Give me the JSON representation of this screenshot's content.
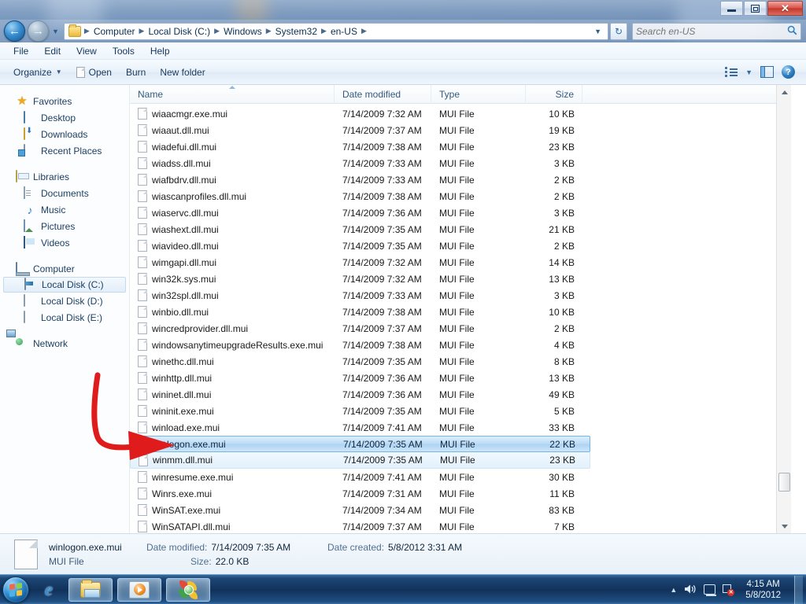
{
  "window": {
    "titlebar_buttons": [
      {
        "name": "minimize",
        "glyph": "—"
      },
      {
        "name": "restore",
        "glyph": "❐"
      },
      {
        "name": "close",
        "glyph": "✕"
      }
    ]
  },
  "address_bar": {
    "back_glyph": "←",
    "forward_glyph": "→",
    "history_caret": "▼",
    "folder_icon": "folder-icon",
    "breadcrumbs": [
      "Computer",
      "Local Disk (C:)",
      "Windows",
      "System32",
      "en-US"
    ],
    "separator": "▶",
    "dropdown_caret": "▼",
    "refresh_glyph": "↻",
    "search": {
      "placeholder": "Search en-US",
      "value": "",
      "icon": "search-icon"
    }
  },
  "menu": {
    "items": [
      "File",
      "Edit",
      "View",
      "Tools",
      "Help"
    ]
  },
  "toolbar": {
    "organize_label": "Organize",
    "organize_caret": "▼",
    "open_label": "Open",
    "burn_label": "Burn",
    "new_folder_label": "New folder",
    "view_caret": "▼",
    "help_glyph": "?"
  },
  "navigation_pane": {
    "groups": [
      {
        "root": {
          "label": "Favorites",
          "icon": "star-icon"
        },
        "children": [
          {
            "label": "Desktop",
            "icon": "desktop-icon"
          },
          {
            "label": "Downloads",
            "icon": "downloads-icon"
          },
          {
            "label": "Recent Places",
            "icon": "recent-places-icon"
          }
        ]
      },
      {
        "root": {
          "label": "Libraries",
          "icon": "libraries-icon"
        },
        "children": [
          {
            "label": "Documents",
            "icon": "documents-icon"
          },
          {
            "label": "Music",
            "icon": "music-icon"
          },
          {
            "label": "Pictures",
            "icon": "pictures-icon"
          },
          {
            "label": "Videos",
            "icon": "videos-icon"
          }
        ]
      },
      {
        "root": {
          "label": "Computer",
          "icon": "computer-icon"
        },
        "children": [
          {
            "label": "Local Disk (C:)",
            "icon": "system-drive-icon",
            "selected": true
          },
          {
            "label": "Local Disk (D:)",
            "icon": "drive-icon"
          },
          {
            "label": "Local Disk (E:)",
            "icon": "drive-icon"
          }
        ]
      },
      {
        "root": {
          "label": "Network",
          "icon": "network-icon"
        },
        "children": []
      }
    ]
  },
  "file_list": {
    "columns": [
      "Name",
      "Date modified",
      "Type",
      "Size"
    ],
    "sort_column": "Name",
    "sort_direction": "ascending",
    "rows": [
      {
        "name": "wiaacmgr.exe.mui",
        "date": "7/14/2009 7:32 AM",
        "type": "MUI File",
        "size": "10 KB"
      },
      {
        "name": "wiaaut.dll.mui",
        "date": "7/14/2009 7:37 AM",
        "type": "MUI File",
        "size": "19 KB"
      },
      {
        "name": "wiadefui.dll.mui",
        "date": "7/14/2009 7:38 AM",
        "type": "MUI File",
        "size": "23 KB"
      },
      {
        "name": "wiadss.dll.mui",
        "date": "7/14/2009 7:33 AM",
        "type": "MUI File",
        "size": "3 KB"
      },
      {
        "name": "wiafbdrv.dll.mui",
        "date": "7/14/2009 7:33 AM",
        "type": "MUI File",
        "size": "2 KB"
      },
      {
        "name": "wiascanprofiles.dll.mui",
        "date": "7/14/2009 7:38 AM",
        "type": "MUI File",
        "size": "2 KB"
      },
      {
        "name": "wiaservc.dll.mui",
        "date": "7/14/2009 7:36 AM",
        "type": "MUI File",
        "size": "3 KB"
      },
      {
        "name": "wiashext.dll.mui",
        "date": "7/14/2009 7:35 AM",
        "type": "MUI File",
        "size": "21 KB"
      },
      {
        "name": "wiavideo.dll.mui",
        "date": "7/14/2009 7:35 AM",
        "type": "MUI File",
        "size": "2 KB"
      },
      {
        "name": "wimgapi.dll.mui",
        "date": "7/14/2009 7:32 AM",
        "type": "MUI File",
        "size": "14 KB"
      },
      {
        "name": "win32k.sys.mui",
        "date": "7/14/2009 7:32 AM",
        "type": "MUI File",
        "size": "13 KB"
      },
      {
        "name": "win32spl.dll.mui",
        "date": "7/14/2009 7:33 AM",
        "type": "MUI File",
        "size": "3 KB"
      },
      {
        "name": "winbio.dll.mui",
        "date": "7/14/2009 7:38 AM",
        "type": "MUI File",
        "size": "10 KB"
      },
      {
        "name": "wincredprovider.dll.mui",
        "date": "7/14/2009 7:37 AM",
        "type": "MUI File",
        "size": "2 KB"
      },
      {
        "name": "windowsanytimeupgradeResults.exe.mui",
        "date": "7/14/2009 7:38 AM",
        "type": "MUI File",
        "size": "4 KB"
      },
      {
        "name": "winethc.dll.mui",
        "date": "7/14/2009 7:35 AM",
        "type": "MUI File",
        "size": "8 KB"
      },
      {
        "name": "winhttp.dll.mui",
        "date": "7/14/2009 7:36 AM",
        "type": "MUI File",
        "size": "13 KB"
      },
      {
        "name": "wininet.dll.mui",
        "date": "7/14/2009 7:36 AM",
        "type": "MUI File",
        "size": "49 KB"
      },
      {
        "name": "wininit.exe.mui",
        "date": "7/14/2009 7:35 AM",
        "type": "MUI File",
        "size": "5 KB"
      },
      {
        "name": "winload.exe.mui",
        "date": "7/14/2009 7:41 AM",
        "type": "MUI File",
        "size": "33 KB"
      },
      {
        "name": "winlogon.exe.mui",
        "date": "7/14/2009 7:35 AM",
        "type": "MUI File",
        "size": "22 KB",
        "selected": true
      },
      {
        "name": "winmm.dll.mui",
        "date": "7/14/2009 7:35 AM",
        "type": "MUI File",
        "size": "23 KB",
        "secondary": true
      },
      {
        "name": "winresume.exe.mui",
        "date": "7/14/2009 7:41 AM",
        "type": "MUI File",
        "size": "30 KB"
      },
      {
        "name": "Winrs.exe.mui",
        "date": "7/14/2009 7:31 AM",
        "type": "MUI File",
        "size": "11 KB"
      },
      {
        "name": "WinSAT.exe.mui",
        "date": "7/14/2009 7:34 AM",
        "type": "MUI File",
        "size": "83 KB"
      },
      {
        "name": "WinSATAPI.dll.mui",
        "date": "7/14/2009 7:37 AM",
        "type": "MUI File",
        "size": "7 KB"
      }
    ]
  },
  "details_pane": {
    "file_name": "winlogon.exe.mui",
    "file_kind": "MUI File",
    "date_modified_label": "Date modified:",
    "date_modified_value": "7/14/2009 7:35 AM",
    "size_label": "Size:",
    "size_value": "22.0 KB",
    "date_created_label": "Date created:",
    "date_created_value": "5/8/2012 3:31 AM"
  },
  "taskbar": {
    "start_label": "start-orb",
    "buttons": [
      {
        "name": "internet-explorer",
        "active": false
      },
      {
        "name": "windows-explorer",
        "active": true
      },
      {
        "name": "windows-media-player",
        "active": true
      },
      {
        "name": "chrome-browser",
        "active": true
      }
    ],
    "tray": {
      "show_hidden_glyph": "▲",
      "volume_glyph": "🔊",
      "network_icon": "network-tray-icon",
      "action_center_icon": "action-center-icon",
      "action_center_badge": "✕",
      "time": "4:15 AM",
      "date": "5/8/2012"
    }
  },
  "annotation": {
    "type": "hand-drawn-arrow",
    "color": "#e01b1b",
    "points_at": "winlogon.exe.mui"
  }
}
